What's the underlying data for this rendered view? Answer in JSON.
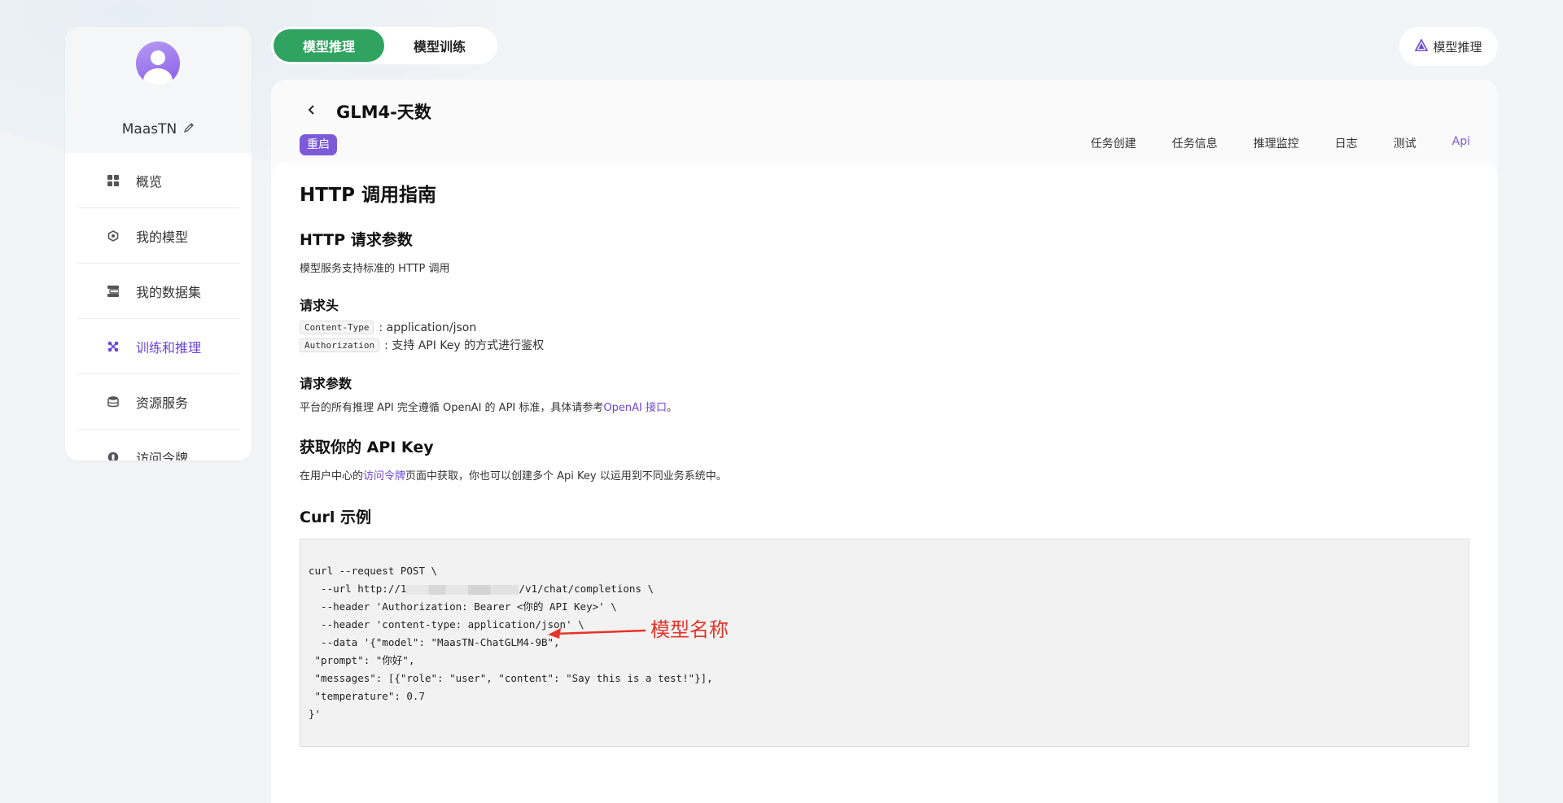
{
  "sidebar": {
    "username": "MaasTN",
    "items": [
      {
        "label": "概览",
        "icon": "grid-icon"
      },
      {
        "label": "我的模型",
        "icon": "hexagon-icon"
      },
      {
        "label": "我的数据集",
        "icon": "dataset-icon"
      },
      {
        "label": "训练和推理",
        "icon": "train-icon",
        "active": true
      },
      {
        "label": "资源服务",
        "icon": "database-icon"
      },
      {
        "label": "访问令牌",
        "icon": "token-icon"
      }
    ]
  },
  "top_tabs": [
    {
      "label": "模型推理",
      "active": true
    },
    {
      "label": "模型训练",
      "active": false
    }
  ],
  "corner_button": {
    "label": "模型推理",
    "icon": "triangle-icon"
  },
  "header": {
    "title": "GLM4-天数",
    "badge": "重启",
    "tabs": [
      "任务创建",
      "任务信息",
      "推理监控",
      "日志",
      "测试",
      "Api"
    ],
    "active_tab": "Api"
  },
  "content": {
    "h1": "HTTP 调用指南",
    "request_params_title": "HTTP 请求参数",
    "request_params_desc": "模型服务支持标准的 HTTP 调用",
    "headers_title": "请求头",
    "headers": [
      {
        "key": "Content-Type",
        "value": ": application/json"
      },
      {
        "key": "Authorization",
        "value": ": 支持 API Key 的方式进行鉴权"
      }
    ],
    "req_params_title": "请求参数",
    "req_params_desc_prefix": "平台的所有推理 API 完全遵循 OpenAI 的 API 标准，具体请参考",
    "req_params_link": "OpenAI 接口",
    "req_params_desc_suffix": "。",
    "api_key_title": "获取你的 API Key",
    "api_key_prefix": "在用户中心的",
    "api_key_link": "访问令牌",
    "api_key_suffix": "页面中获取，你也可以创建多个 Api Key 以运用到不同业务系统中。",
    "curl_title": "Curl 示例",
    "curl_lines": [
      "curl --request POST \\",
      "  --url http://1",
      "/v1/chat/completions \\",
      "  --header 'Authorization: Bearer <你的 API Key>' \\",
      "  --header 'content-type: application/json' \\",
      "  --data '{\"model\": \"MaasTN-ChatGLM4-9B\",",
      " \"prompt\": \"你好\",",
      " \"messages\": [{\"role\": \"user\", \"content\": \"Say this is a test!\"}],",
      " \"temperature\": 0.7",
      "}'"
    ],
    "annotation": "模型名称"
  },
  "colors": {
    "accent_purple": "#7c5ad8",
    "active_green": "#2fa35f",
    "annotation_red": "#e5342a"
  }
}
